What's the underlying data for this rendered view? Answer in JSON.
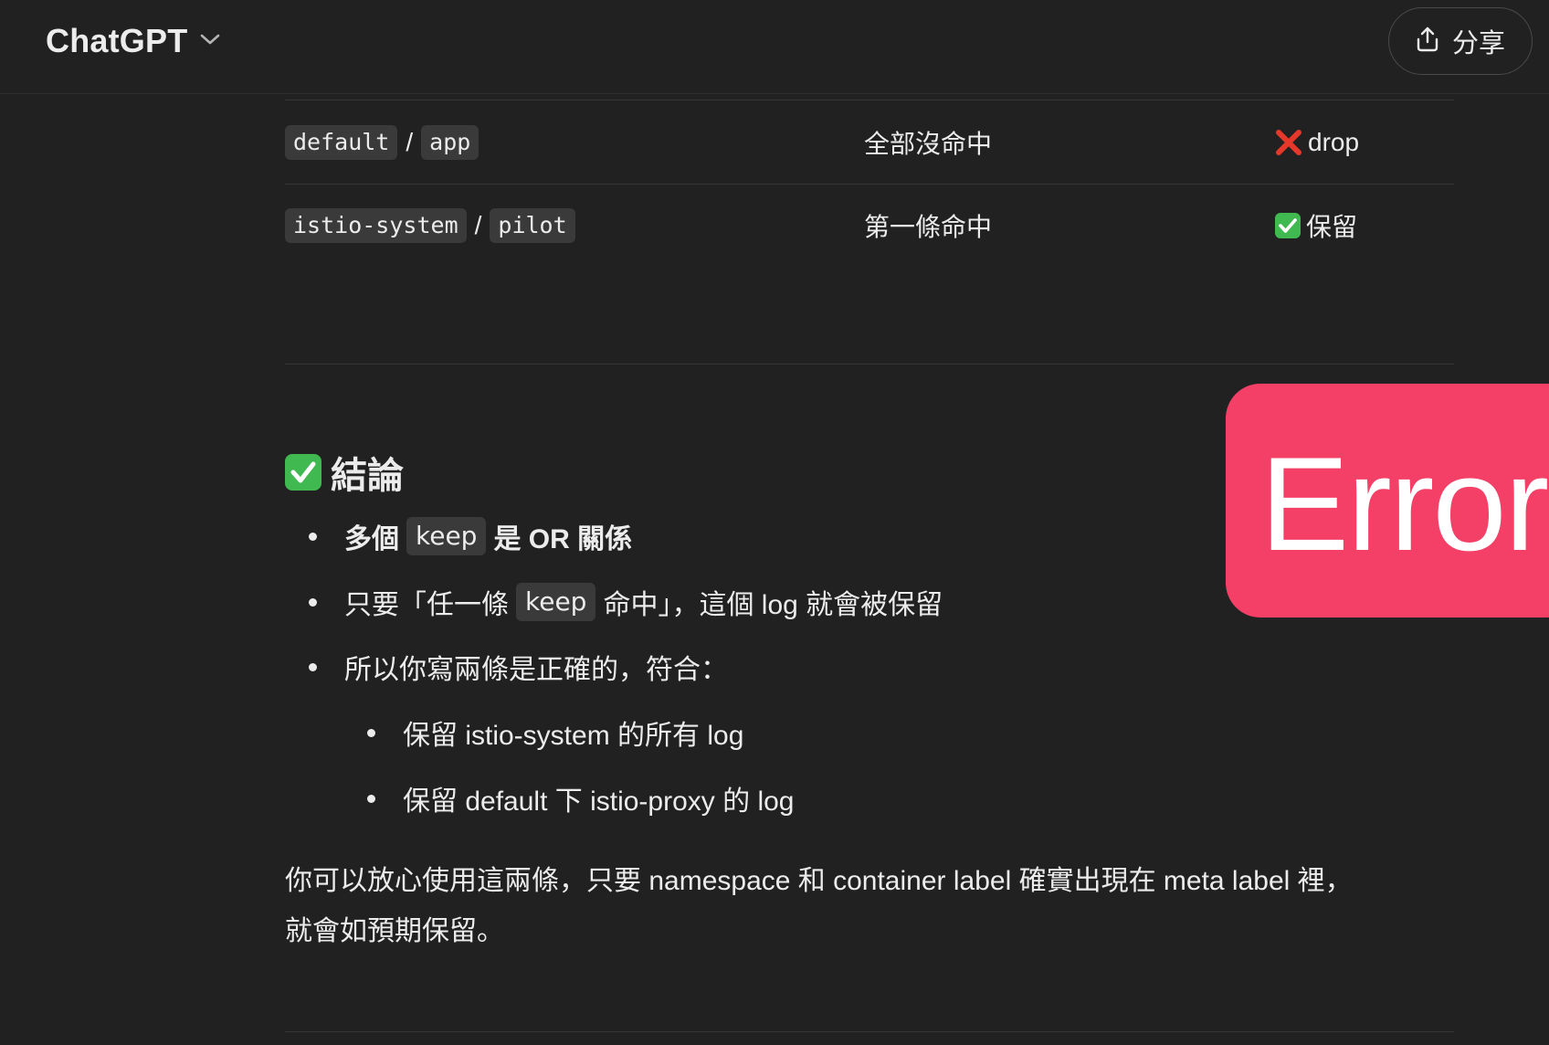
{
  "header": {
    "app_title": "ChatGPT",
    "share_label": "分享"
  },
  "table": {
    "rows": [
      {
        "namespace": "default",
        "separator": "/",
        "container": "app",
        "match": "全部沒命中",
        "result_icon": "red-x-icon",
        "result": "drop"
      },
      {
        "namespace": "istio-system",
        "separator": "/",
        "container": "pilot",
        "match": "第一條命中",
        "result_icon": "green-check-icon",
        "result": "保留"
      }
    ]
  },
  "conclusion": {
    "heading": "結論",
    "bullet1": {
      "before": "多個",
      "code": "keep",
      "after": "是 OR 關係"
    },
    "bullet2": {
      "before": "只要「任一條",
      "code": "keep",
      "after": "命中」，這個 log 就會被保留"
    },
    "bullet3": "所以你寫兩條是正確的，符合：",
    "sub1": "保留 istio-system 的所有 log",
    "sub2": "保留 default 下 istio-proxy 的 log",
    "paragraph_line1": "你可以放心使用這兩條，只要 namespace 和 container label 確實出現在 meta label 裡，",
    "paragraph_line2": "就會如預期保留。"
  },
  "overlay": {
    "error_label": "Error",
    "color": "#f43f67"
  },
  "colors": {
    "background": "#212121",
    "text": "#ececec",
    "code_bg": "#3a3a3a",
    "check_green": "#3fb950",
    "x_red": "#e5382a"
  }
}
